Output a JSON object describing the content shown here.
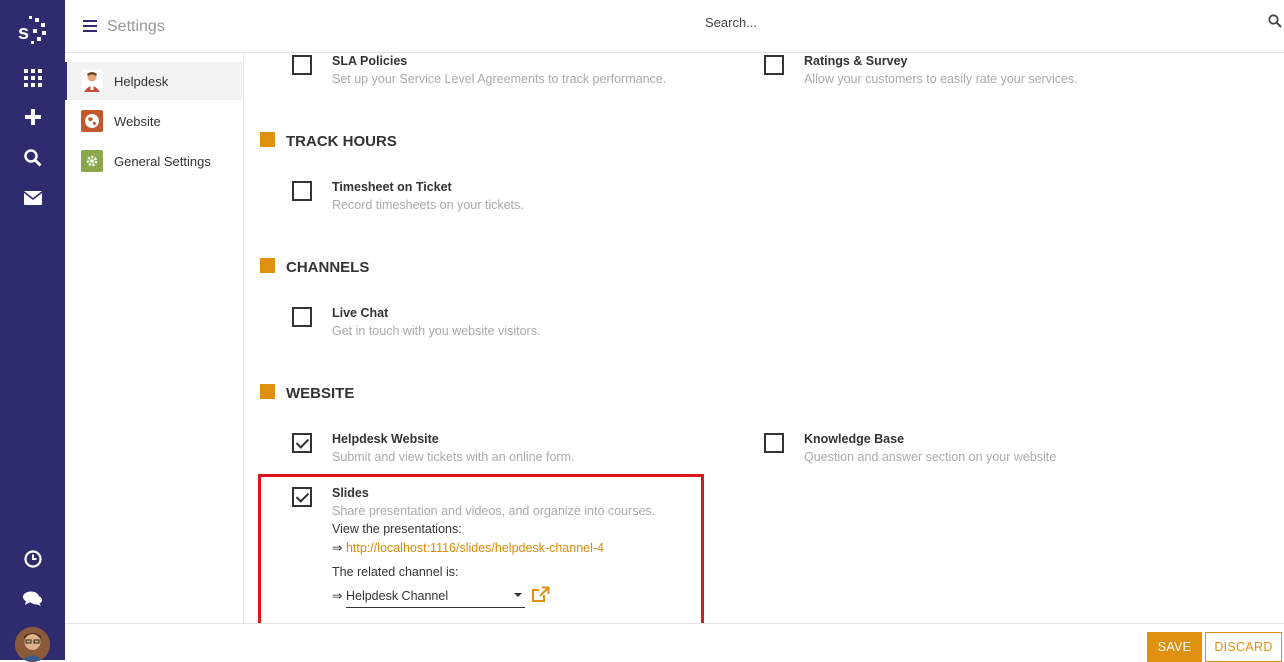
{
  "header": {
    "title": "Settings",
    "search_placeholder": "Search..."
  },
  "sidebar": {
    "items": [
      {
        "label": "Helpdesk",
        "active": true
      },
      {
        "label": "Website",
        "active": false
      },
      {
        "label": "General Settings",
        "active": false
      }
    ]
  },
  "top_settings": [
    {
      "label": "SLA Policies",
      "desc": "Set up your Service Level Agreements to track performance.",
      "checked": false
    },
    {
      "label": "Ratings & Survey",
      "desc": "Allow your customers to easily rate your services.",
      "checked": false
    }
  ],
  "sections": {
    "track_hours": {
      "title": "TRACK HOURS",
      "settings": [
        {
          "label": "Timesheet on Ticket",
          "desc": "Record timesheets on your tickets.",
          "checked": false
        }
      ]
    },
    "channels": {
      "title": "CHANNELS",
      "settings": [
        {
          "label": "Live Chat",
          "desc": "Get in touch with you website visitors.",
          "checked": false
        }
      ]
    },
    "website": {
      "title": "WEBSITE",
      "settings": [
        {
          "label": "Helpdesk Website",
          "desc": "Submit and view tickets with an online form.",
          "checked": true
        },
        {
          "label": "Knowledge Base",
          "desc": "Question and answer section on your website",
          "checked": false
        },
        {
          "label": "Slides",
          "desc": "Share presentation and videos, and organize into courses.",
          "checked": true,
          "view_label": "View the presentations:",
          "arrow": "⇒",
          "url": "http://localhost:1116/slides/helpdesk-channel-4",
          "channel_label": "The related channel is:",
          "channel_value": "Helpdesk Channel"
        }
      ]
    }
  },
  "footer": {
    "save": "SAVE",
    "discard": "DISCARD"
  },
  "colors": {
    "rail": "#2e2b6e",
    "accent": "#e0900f",
    "highlight": "#e0141b"
  }
}
